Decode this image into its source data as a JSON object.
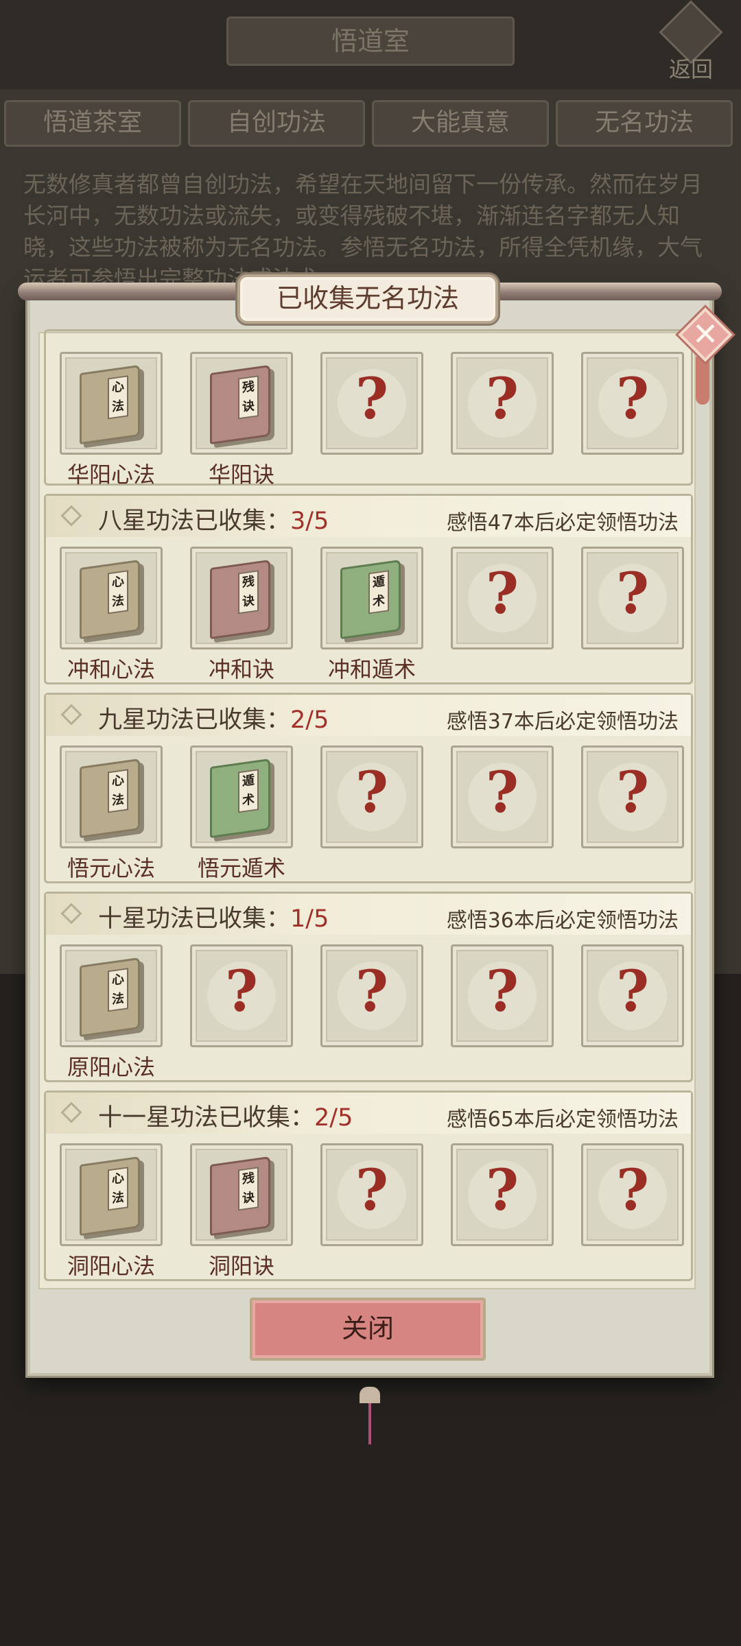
{
  "header": {
    "title": "悟道室",
    "back_label": "返回"
  },
  "tabs": [
    "悟道茶室",
    "自创功法",
    "大能真意",
    "无名功法"
  ],
  "description": "无数修真者都曾自创功法，希望在天地间留下一份传承。然而在岁月长河中，无数功法或流失，或变得残破不堪，渐渐连名字都无人知晓，这些功法被称为无名功法。参悟无名功法，所得全凭机缘，大气运者可参悟出完整功法或法术",
  "modal": {
    "title": "已收集无名功法",
    "close_icon": "close-x-icon",
    "close_button": "关闭",
    "top_row": {
      "items": [
        {
          "name": "华阳心法",
          "book": "tan",
          "glyph": "心法"
        },
        {
          "name": "华阳诀",
          "book": "red",
          "glyph": "残诀"
        },
        {
          "name": "",
          "book": "unknown"
        },
        {
          "name": "",
          "book": "unknown"
        },
        {
          "name": "",
          "book": "unknown"
        }
      ]
    },
    "sections": [
      {
        "title": "八星功法已收集：",
        "count": "3/5",
        "note": "感悟47本后必定领悟功法",
        "items": [
          {
            "name": "冲和心法",
            "book": "tan",
            "glyph": "心法"
          },
          {
            "name": "冲和诀",
            "book": "red",
            "glyph": "残诀"
          },
          {
            "name": "冲和遁术",
            "book": "green",
            "glyph": "遁术"
          },
          {
            "name": "",
            "book": "unknown"
          },
          {
            "name": "",
            "book": "unknown"
          }
        ]
      },
      {
        "title": "九星功法已收集：",
        "count": "2/5",
        "note": "感悟37本后必定领悟功法",
        "items": [
          {
            "name": "悟元心法",
            "book": "tan",
            "glyph": "心法"
          },
          {
            "name": "悟元遁术",
            "book": "green",
            "glyph": "遁术"
          },
          {
            "name": "",
            "book": "unknown"
          },
          {
            "name": "",
            "book": "unknown"
          },
          {
            "name": "",
            "book": "unknown"
          }
        ]
      },
      {
        "title": "十星功法已收集：",
        "count": "1/5",
        "note": "感悟36本后必定领悟功法",
        "items": [
          {
            "name": "原阳心法",
            "book": "tan",
            "glyph": "心法"
          },
          {
            "name": "",
            "book": "unknown"
          },
          {
            "name": "",
            "book": "unknown"
          },
          {
            "name": "",
            "book": "unknown"
          },
          {
            "name": "",
            "book": "unknown"
          }
        ]
      },
      {
        "title": "十一星功法已收集：",
        "count": "2/5",
        "note": "感悟65本后必定领悟功法",
        "items": [
          {
            "name": "洞阳心法",
            "book": "tan",
            "glyph": "心法"
          },
          {
            "name": "洞阳诀",
            "book": "red",
            "glyph": "残诀"
          },
          {
            "name": "",
            "book": "unknown"
          },
          {
            "name": "",
            "book": "unknown"
          },
          {
            "name": "",
            "book": "unknown"
          }
        ]
      }
    ],
    "unknown_mark": "?"
  },
  "colors": {
    "accent_red": "#a2302a",
    "button": "#d78582",
    "panel": "#ebe8d6"
  }
}
